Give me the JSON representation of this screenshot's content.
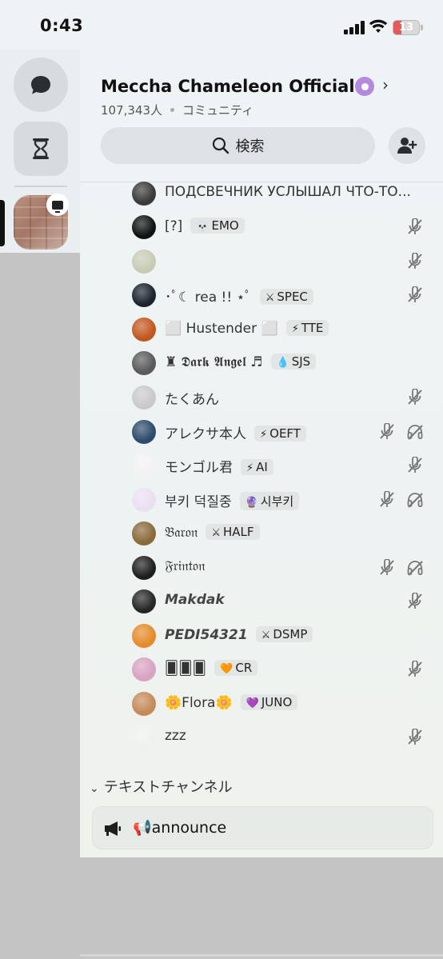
{
  "status": {
    "time": "0:43",
    "battery": "13"
  },
  "server": {
    "title": "Meccha Chameleon Official",
    "member_count": "107,343人",
    "type": "コミュニティ",
    "search_label": "検索"
  },
  "members": [
    {
      "name": "ПОДСВЕЧНИК УСЛЫШАЛ ЧТО-ТО...",
      "tag": "",
      "tag_icon": "",
      "muted": false,
      "deaf": false,
      "avatar": "#3a3a3a"
    },
    {
      "name": "[?]",
      "tag": "EMO",
      "tag_icon": "💀",
      "muted": true,
      "deaf": false,
      "avatar": "#0d1412"
    },
    {
      "name": "",
      "tag": "",
      "tag_icon": "",
      "muted": true,
      "deaf": false,
      "avatar": "#c8cbb4"
    },
    {
      "name": "･ﾟ☾ rea !! ⋆ﾟ",
      "tag": "SPEC",
      "tag_icon": "⚔",
      "muted": true,
      "deaf": false,
      "avatar": "#1d2430"
    },
    {
      "name": "⬜ Hustender ⬜",
      "tag": "TTE",
      "tag_icon": "⚡",
      "muted": false,
      "deaf": false,
      "avatar": "#c2571e"
    },
    {
      "name": "♜ 𝕯𝖆𝖗𝖐 𝕬𝖓𝖌𝖊𝖑 ♬",
      "tag": "SJS",
      "tag_icon": "💧",
      "muted": false,
      "deaf": false,
      "avatar": "#5a5a5a"
    },
    {
      "name": "たくあん",
      "tag": "",
      "tag_icon": "",
      "muted": true,
      "deaf": false,
      "avatar": "#c9c9cc"
    },
    {
      "name": "アレクサ本人",
      "tag": "OEFT",
      "tag_icon": "⚡",
      "muted": true,
      "deaf": true,
      "avatar": "#2d4b6a"
    },
    {
      "name": "モンゴル君",
      "tag": "AI",
      "tag_icon": "⚡",
      "muted": true,
      "deaf": false,
      "avatar": "#f2f2f2"
    },
    {
      "name": "부키 덕질중",
      "tag": "시부키",
      "tag_icon": "🔮",
      "muted": true,
      "deaf": true,
      "avatar": "#e9dff2"
    },
    {
      "name": "𝔅𝔞𝔯𝔬𝔫",
      "tag": "HALF",
      "tag_icon": "⚔",
      "muted": false,
      "deaf": false,
      "avatar": "#8a6a3a"
    },
    {
      "name": "𝔉𝔯𝔦𝔫𝔱𝔬𝔫",
      "tag": "",
      "tag_icon": "",
      "muted": true,
      "deaf": true,
      "avatar": "#1e1e1e"
    },
    {
      "name": "Makdak",
      "tag": "",
      "tag_icon": "",
      "muted": true,
      "deaf": false,
      "avatar": "#262626"
    },
    {
      "name": "PEDI54321",
      "tag": "DSMP",
      "tag_icon": "⚔",
      "muted": false,
      "deaf": false,
      "avatar": "#e58b2b"
    },
    {
      "name": "🂠🂠🂠",
      "tag": "CR",
      "tag_icon": "🧡",
      "muted": true,
      "deaf": false,
      "avatar": "#d8a2c2"
    },
    {
      "name": "🌼Flora🌼",
      "tag": "JUNO",
      "tag_icon": "💜",
      "muted": false,
      "deaf": false,
      "avatar": "#c58a5a"
    },
    {
      "name": "zzz",
      "tag": "",
      "tag_icon": "",
      "muted": true,
      "deaf": false,
      "avatar": "#f0f0f0"
    }
  ],
  "category": {
    "label": "テキストチャンネル"
  },
  "channels": [
    {
      "name": "📢announce"
    }
  ]
}
